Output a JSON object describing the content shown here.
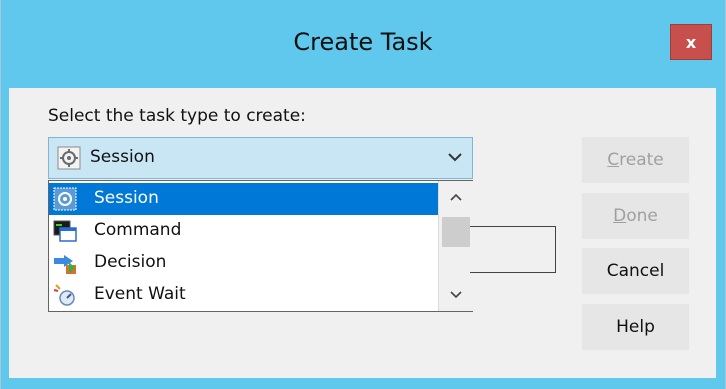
{
  "window": {
    "title": "Create Task",
    "close_glyph": "x",
    "title_bar_color": "#5fc8ec",
    "close_color": "#c7504c"
  },
  "dialog": {
    "prompt": "Select the task type to create:",
    "combo": {
      "selected": "Session",
      "icon": "session-gear-icon"
    },
    "list": {
      "items": [
        {
          "label": "Session",
          "icon": "session-gear-icon",
          "selected": true
        },
        {
          "label": "Command",
          "icon": "command-window-icon",
          "selected": false
        },
        {
          "label": "Decision",
          "icon": "decision-icon",
          "selected": false
        },
        {
          "label": "Event Wait",
          "icon": "event-wait-icon",
          "selected": false
        }
      ],
      "selection_color": "#0078d7"
    },
    "buttons": {
      "create": {
        "first": "C",
        "rest": "reate",
        "enabled": false
      },
      "done": {
        "first": "D",
        "rest": "one",
        "enabled": false
      },
      "cancel": {
        "label": "Cancel",
        "enabled": true
      },
      "help": {
        "label": "Help",
        "enabled": true
      }
    }
  }
}
